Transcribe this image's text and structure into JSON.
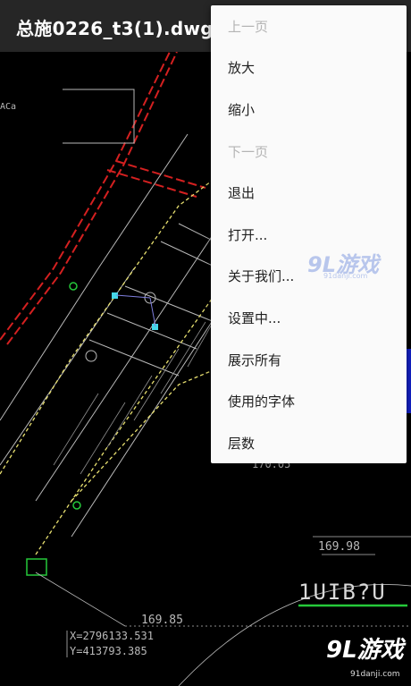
{
  "app_bar": {
    "title": "总施0226_t3(1).dwg"
  },
  "menu": {
    "items": [
      {
        "label": "上一页",
        "enabled": false
      },
      {
        "label": "放大",
        "enabled": true
      },
      {
        "label": "缩小",
        "enabled": true
      },
      {
        "label": "下一页",
        "enabled": false
      },
      {
        "label": "退出",
        "enabled": true
      },
      {
        "label": "打开...",
        "enabled": true
      },
      {
        "label": "关于我们...",
        "enabled": true
      },
      {
        "label": "设置中...",
        "enabled": true
      },
      {
        "label": "展示所有",
        "enabled": true
      },
      {
        "label": "使用的字体",
        "enabled": true
      },
      {
        "label": "层数",
        "enabled": true
      }
    ]
  },
  "drawing": {
    "dim_1": "170.05",
    "dim_2": "169.98",
    "dim_3": "169.85",
    "coord_x": "X=2796133.531",
    "coord_y": "Y=413793.385",
    "block_text": "1UIB?U",
    "small_label": "ACa"
  },
  "watermarks": {
    "mid_brand": "9L游戏",
    "mid_url": "91danji.com",
    "bottom_brand": "9L游戏",
    "bottom_url": "91danji.com"
  },
  "colors": {
    "app_bar": "#262626",
    "menu_bg": "#fafafa",
    "menu_text": "#1f1f1f",
    "menu_disabled": "#b4b4b4",
    "cad_red": "#d42020",
    "cad_yellow": "#e8e070",
    "cad_grey": "#b9b9b9",
    "cad_green": "#25c93a",
    "cad_cyan": "#45d7e8",
    "accent_blue": "#1220c8"
  }
}
